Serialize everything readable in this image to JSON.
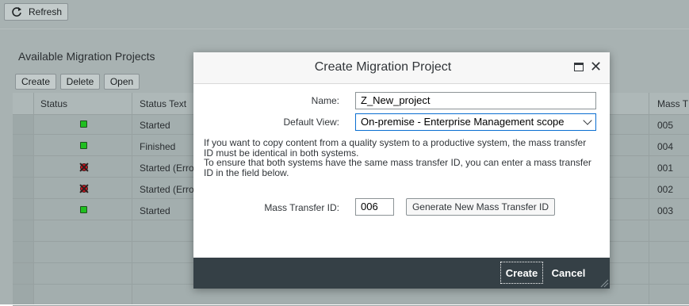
{
  "toolbar": {
    "refresh_label": "Refresh"
  },
  "section": {
    "title": "Available Migration Projects"
  },
  "actions": {
    "create": "Create",
    "delete": "Delete",
    "open": "Open"
  },
  "table": {
    "columns": {
      "status": "Status",
      "status_text": "Status Text",
      "mass_transfer": "Mass T"
    },
    "rows": [
      {
        "status": "ok",
        "status_text": "Started",
        "mass_transfer": "005"
      },
      {
        "status": "ok",
        "status_text": "Finished",
        "mass_transfer": "004"
      },
      {
        "status": "error",
        "status_text": "Started (Erro",
        "mass_transfer": "001"
      },
      {
        "status": "error",
        "status_text": "Started (Erro",
        "mass_transfer": "002"
      },
      {
        "status": "ok",
        "status_text": "Started",
        "mass_transfer": "003"
      }
    ]
  },
  "dialog": {
    "title": "Create Migration Project",
    "name_label": "Name:",
    "name_value": "Z_New_project",
    "default_view_label": "Default View:",
    "default_view_value": "On-premise - Enterprise Management scope",
    "info_lines": [
      "If you want to copy content from a quality system to a productive system, the mass transfer",
      "ID must be identical in both systems.",
      "To ensure that both systems have the same mass transfer ID, you can enter a mass transfer",
      "ID in the field below."
    ],
    "mass_transfer_label": "Mass Transfer ID:",
    "mass_transfer_value": "006",
    "generate_button": "Generate New Mass Transfer ID",
    "create_button": "Create",
    "cancel_button": "Cancel"
  },
  "icons": {
    "refresh": "refresh-icon",
    "maximize": "maximize-icon",
    "close": "close-icon",
    "status_ok": "status-ok-icon",
    "status_error": "status-error-icon"
  },
  "colors": {
    "footer_bar": "#354046",
    "select_border": "#0a6ed1",
    "status_ok": "#1fbf1f",
    "status_error": "#d0141e"
  }
}
